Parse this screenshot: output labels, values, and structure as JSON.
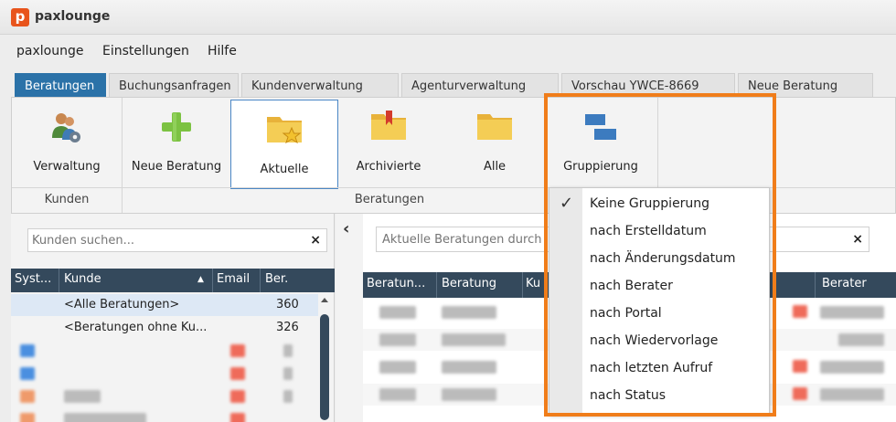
{
  "app": {
    "logo_letter": "p",
    "title": "paxlounge",
    "brand_color": "#e8541c"
  },
  "menu": [
    "paxlounge",
    "Einstellungen",
    "Hilfe"
  ],
  "tabs": [
    {
      "label": "Beratungen",
      "active": true
    },
    {
      "label": "Buchungsanfragen",
      "active": false
    },
    {
      "label": "Kundenverwaltung",
      "active": false
    },
    {
      "label": "Agenturverwaltung",
      "active": false
    },
    {
      "label": "Vorschau YWCE-8669",
      "active": false
    },
    {
      "label": "Neue Beratung",
      "active": false
    }
  ],
  "ribbon": {
    "buttons": {
      "verwaltung": "Verwaltung",
      "neue_beratung": "Neue Beratung",
      "aktuelle": "Aktuelle",
      "archivierte": "Archivierte",
      "alle": "Alle",
      "gruppierung": "Gruppierung"
    },
    "groups": {
      "kunden": "Kunden",
      "beratungen": "Beratungen"
    }
  },
  "left": {
    "search_placeholder": "Kunden suchen...",
    "columns": [
      "Syst...",
      "Kunde",
      "Email",
      "Ber."
    ],
    "rows": [
      {
        "kunde": "<Alle Beratungen>",
        "ber": "360"
      },
      {
        "kunde": "<Beratungen ohne Ku...",
        "ber": "326"
      }
    ]
  },
  "right": {
    "search_placeholder": "Aktuelle Beratungen durch",
    "columns": [
      "Beratun...",
      "Beratung",
      "Ku",
      "Berater"
    ]
  },
  "grouping_menu": {
    "items": [
      {
        "label": "Keine Gruppierung",
        "checked": true
      },
      {
        "label": "nach Erstelldatum",
        "checked": false
      },
      {
        "label": "nach Änderungsdatum",
        "checked": false
      },
      {
        "label": "nach Berater",
        "checked": false
      },
      {
        "label": "nach Portal",
        "checked": false
      },
      {
        "label": "nach Wiedervorlage",
        "checked": false
      },
      {
        "label": "nach letzten Aufruf",
        "checked": false
      },
      {
        "label": "nach Status",
        "checked": false
      }
    ]
  },
  "icons": {
    "clear": "×",
    "check": "✓",
    "collapse": "‹"
  },
  "colors": {
    "active_tab": "#2b72a8",
    "grid_header": "#34495c",
    "highlight": "#f07d1a"
  }
}
